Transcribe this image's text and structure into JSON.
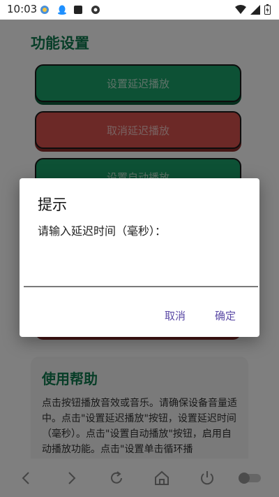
{
  "status_bar": {
    "time": "10:03",
    "icons": [
      "app-icon",
      "qq-icon",
      "notification-box-icon",
      "camera-icon"
    ],
    "right_icons": [
      "wifi-icon",
      "cell-signal-icon",
      "battery-icon"
    ]
  },
  "app": {
    "section_title": "功能设置",
    "buttons": [
      {
        "label": "设置延迟播放",
        "color": "#1aa36a"
      },
      {
        "label": "取消延迟播放",
        "color": "#d9534f"
      },
      {
        "label": "设置自动播放",
        "color": "#1aa36a"
      }
    ],
    "help": {
      "title": "使用帮助",
      "text": "点击按钮播放音效或音乐。请确保设备音量适中。点击\"设置延迟播放\"按钮，设置延迟时间（毫秒）。点击\"设置自动播放\"按钮，启用自动播放功能。点击\"设置单击循环播"
    }
  },
  "dialog": {
    "title": "提示",
    "message": "请输入延迟时间（毫秒）：",
    "input_value": "",
    "cancel_label": "取消",
    "ok_label": "确定"
  },
  "nav_bar": {
    "icons": [
      "back-icon",
      "forward-icon",
      "refresh-icon",
      "home-icon",
      "power-icon",
      "toggle-icon"
    ]
  },
  "colors": {
    "accent_green": "#0f7a4f",
    "dialog_button": "#5b4aa6"
  }
}
